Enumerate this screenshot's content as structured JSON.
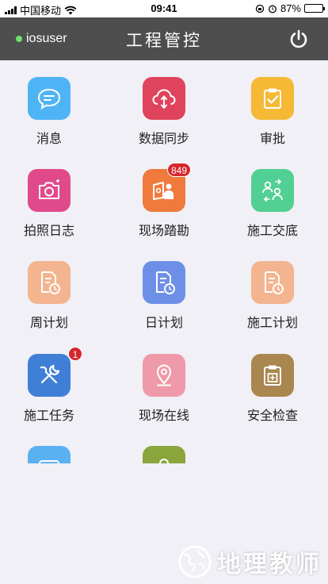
{
  "status_bar": {
    "carrier": "中国移动",
    "time": "09:41",
    "battery": "87%",
    "battery_level": 0.87
  },
  "header": {
    "user": "iosuser",
    "title": "工程管控"
  },
  "tiles": [
    {
      "label": "消息",
      "icon": "message-bubble-icon",
      "color": "#4fb4f5"
    },
    {
      "label": "数据同步",
      "icon": "cloud-sync-icon",
      "color": "#e0445c"
    },
    {
      "label": "审批",
      "icon": "clipboard-check-icon",
      "color": "#f5b935"
    },
    {
      "label": "拍照日志",
      "icon": "camera-icon",
      "color": "#e14a8a"
    },
    {
      "label": "现场踏勘",
      "icon": "survey-worker-icon",
      "color": "#ef7a3c",
      "badge": "849"
    },
    {
      "label": "施工交底",
      "icon": "people-exchange-icon",
      "color": "#52cf92"
    },
    {
      "label": "周计划",
      "icon": "document-clock-icon",
      "color": "#f3b490"
    },
    {
      "label": "日计划",
      "icon": "document-clock-icon",
      "color": "#6e8fe8"
    },
    {
      "label": "施工计划",
      "icon": "document-clock-icon",
      "color": "#f3b490"
    },
    {
      "label": "施工任务",
      "icon": "wrench-screwdriver-icon",
      "color": "#3f7fd6",
      "badge": "1"
    },
    {
      "label": "现场在线",
      "icon": "map-pin-icon",
      "color": "#ef9aaa"
    },
    {
      "label": "安全检查",
      "icon": "safety-check-icon",
      "color": "#a9874f"
    },
    {
      "label": "",
      "icon": "bus-icon",
      "color": "#5ab0f0"
    },
    {
      "label": "",
      "icon": "user-icon",
      "color": "#8aa53c"
    }
  ],
  "watermark": "地理教师"
}
